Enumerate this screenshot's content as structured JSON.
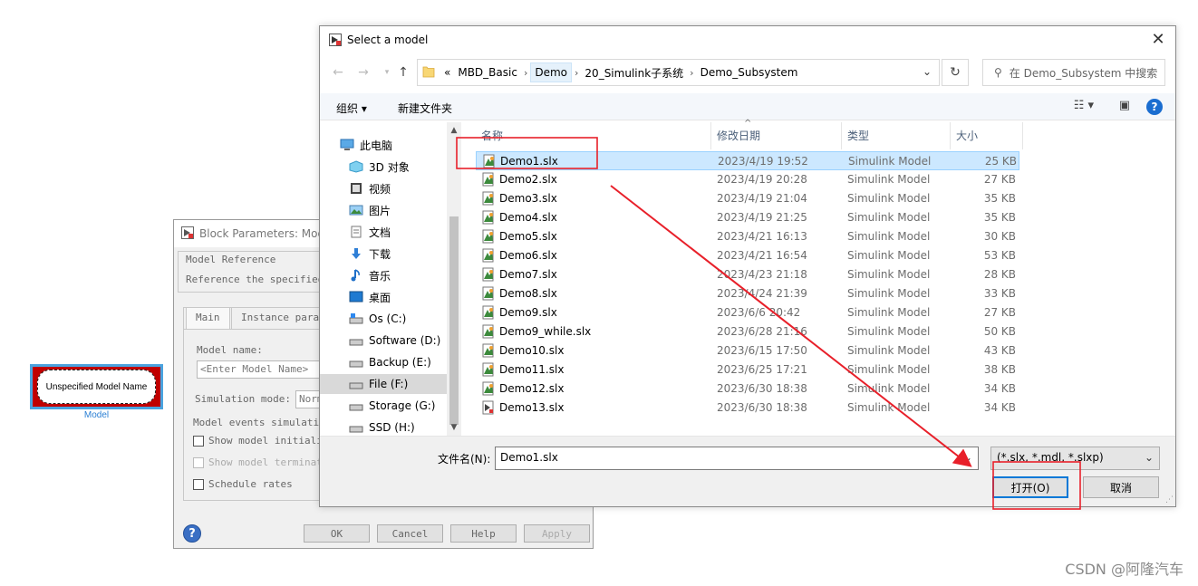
{
  "canvas": {
    "model_block": {
      "label": "Unspecified Model Name",
      "caption": "Model"
    }
  },
  "block_params": {
    "title": "Block Parameters: Mod",
    "group_title": "Model Reference",
    "group_desc": "Reference the specified",
    "tabs": [
      "Main",
      "Instance param"
    ],
    "model_name_label": "Model name:",
    "model_name_placeholder": "<Enter Model Name>",
    "sim_mode_label": "Simulation mode:",
    "sim_mode_value": "Norm",
    "events_label": "Model events simulatio",
    "checkboxes": [
      "Show model initiali",
      "Show model terminat",
      "Schedule rates"
    ],
    "buttons": {
      "ok": "OK",
      "cancel": "Cancel",
      "help": "Help",
      "apply": "Apply"
    }
  },
  "select_model": {
    "title": "Select a model",
    "breadcrumb": {
      "prefix": "«",
      "items": [
        "MBD_Basic",
        "Demo",
        "20_Simulink子系统",
        "Demo_Subsystem"
      ]
    },
    "search_placeholder": "在 Demo_Subsystem 中搜索",
    "toolbar": {
      "organize": "组织 ▾",
      "new_folder": "新建文件夹"
    },
    "nav_items": [
      {
        "label": "此电脑",
        "icon": "pc-icon"
      },
      {
        "label": "3D 对象",
        "icon": "cube-icon"
      },
      {
        "label": "视频",
        "icon": "video-icon"
      },
      {
        "label": "图片",
        "icon": "picture-icon"
      },
      {
        "label": "文档",
        "icon": "document-icon"
      },
      {
        "label": "下载",
        "icon": "download-icon"
      },
      {
        "label": "音乐",
        "icon": "music-icon"
      },
      {
        "label": "桌面",
        "icon": "desktop-icon"
      },
      {
        "label": "Os (C:)",
        "icon": "drive-icon"
      },
      {
        "label": "Software (D:)",
        "icon": "drive-icon"
      },
      {
        "label": "Backup (E:)",
        "icon": "drive-icon"
      },
      {
        "label": "File (F:)",
        "icon": "drive-icon"
      },
      {
        "label": "Storage (G:)",
        "icon": "drive-icon"
      },
      {
        "label": "SSD (H:)",
        "icon": "drive-icon"
      }
    ],
    "columns": {
      "name": "名称",
      "date": "修改日期",
      "type": "类型",
      "size": "大小"
    },
    "files": [
      {
        "name": "Demo1.slx",
        "date": "2023/4/19 19:52",
        "type": "Simulink Model",
        "size": "25 KB"
      },
      {
        "name": "Demo2.slx",
        "date": "2023/4/19 20:28",
        "type": "Simulink Model",
        "size": "27 KB"
      },
      {
        "name": "Demo3.slx",
        "date": "2023/4/19 21:04",
        "type": "Simulink Model",
        "size": "35 KB"
      },
      {
        "name": "Demo4.slx",
        "date": "2023/4/19 21:25",
        "type": "Simulink Model",
        "size": "35 KB"
      },
      {
        "name": "Demo5.slx",
        "date": "2023/4/21 16:13",
        "type": "Simulink Model",
        "size": "30 KB"
      },
      {
        "name": "Demo6.slx",
        "date": "2023/4/21 16:54",
        "type": "Simulink Model",
        "size": "53 KB"
      },
      {
        "name": "Demo7.slx",
        "date": "2023/4/23 21:18",
        "type": "Simulink Model",
        "size": "28 KB"
      },
      {
        "name": "Demo8.slx",
        "date": "2023/4/24 21:39",
        "type": "Simulink Model",
        "size": "33 KB"
      },
      {
        "name": "Demo9.slx",
        "date": "2023/6/6 20:42",
        "type": "Simulink Model",
        "size": "27 KB"
      },
      {
        "name": "Demo9_while.slx",
        "date": "2023/6/28 21:16",
        "type": "Simulink Model",
        "size": "50 KB"
      },
      {
        "name": "Demo10.slx",
        "date": "2023/6/15 17:50",
        "type": "Simulink Model",
        "size": "43 KB"
      },
      {
        "name": "Demo11.slx",
        "date": "2023/6/25 17:21",
        "type": "Simulink Model",
        "size": "38 KB"
      },
      {
        "name": "Demo12.slx",
        "date": "2023/6/30 18:38",
        "type": "Simulink Model",
        "size": "34 KB"
      },
      {
        "name": "Demo13.slx",
        "date": "2023/6/30 18:38",
        "type": "Simulink Model",
        "size": "34 KB"
      }
    ],
    "filename_label": "文件名(N):",
    "filename_value": "Demo1.slx",
    "filter_value": "(*.slx, *.mdl, *.slxp)",
    "open_button": "打开(O)",
    "cancel_button": "取消"
  },
  "watermark": "CSDN @阿隆汽车",
  "colors": {
    "annotation_red": "#e8202a",
    "selection": "#cce8ff",
    "accent": "#0078d7"
  }
}
